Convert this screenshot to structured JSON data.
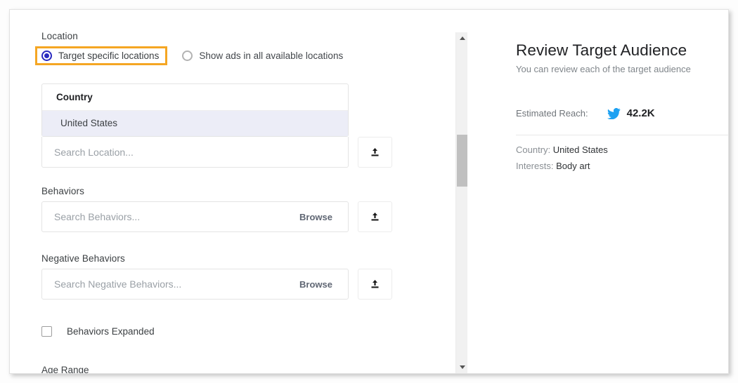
{
  "colors": {
    "highlight_orange": "#f5a623",
    "radio_blue": "#2a2ac0",
    "twitter_blue": "#1da1f2",
    "selected_row_bg": "#ecedf7",
    "scrollbar_thumb": "#c0c0c0"
  },
  "left_panel": {
    "location": {
      "label": "Location",
      "options": [
        {
          "label": "Target specific locations",
          "selected": true,
          "highlighted": true
        },
        {
          "label": "Show ads in all available locations",
          "selected": false,
          "highlighted": false
        }
      ]
    },
    "country_table": {
      "header": "Country",
      "rows": [
        "United States"
      ]
    },
    "location_search": {
      "placeholder": "Search Location...",
      "value": "",
      "upload_icon": "upload-icon"
    },
    "behaviors": {
      "label": "Behaviors",
      "placeholder": "Search Behaviors...",
      "value": "",
      "browse_label": "Browse",
      "upload_icon": "upload-icon"
    },
    "negative_behaviors": {
      "label": "Negative Behaviors",
      "placeholder": "Search Negative Behaviors...",
      "value": "",
      "browse_label": "Browse",
      "upload_icon": "upload-icon"
    },
    "behaviors_expanded": {
      "label": "Behaviors Expanded",
      "checked": false
    },
    "age_range": {
      "label": "Age Range"
    }
  },
  "scrollbar": {
    "up_icon": "chevron-up-icon",
    "down_icon": "chevron-down-icon"
  },
  "right_panel": {
    "title": "Review Target Audience",
    "subtitle": "You can review each of the target audience",
    "estimated_reach": {
      "label": "Estimated Reach:",
      "platform_icon": "twitter-bird-icon",
      "value": "42.2K"
    },
    "summary": [
      {
        "key": "Country:",
        "value": "United States"
      },
      {
        "key": "Interests:",
        "value": "Body art"
      }
    ]
  }
}
